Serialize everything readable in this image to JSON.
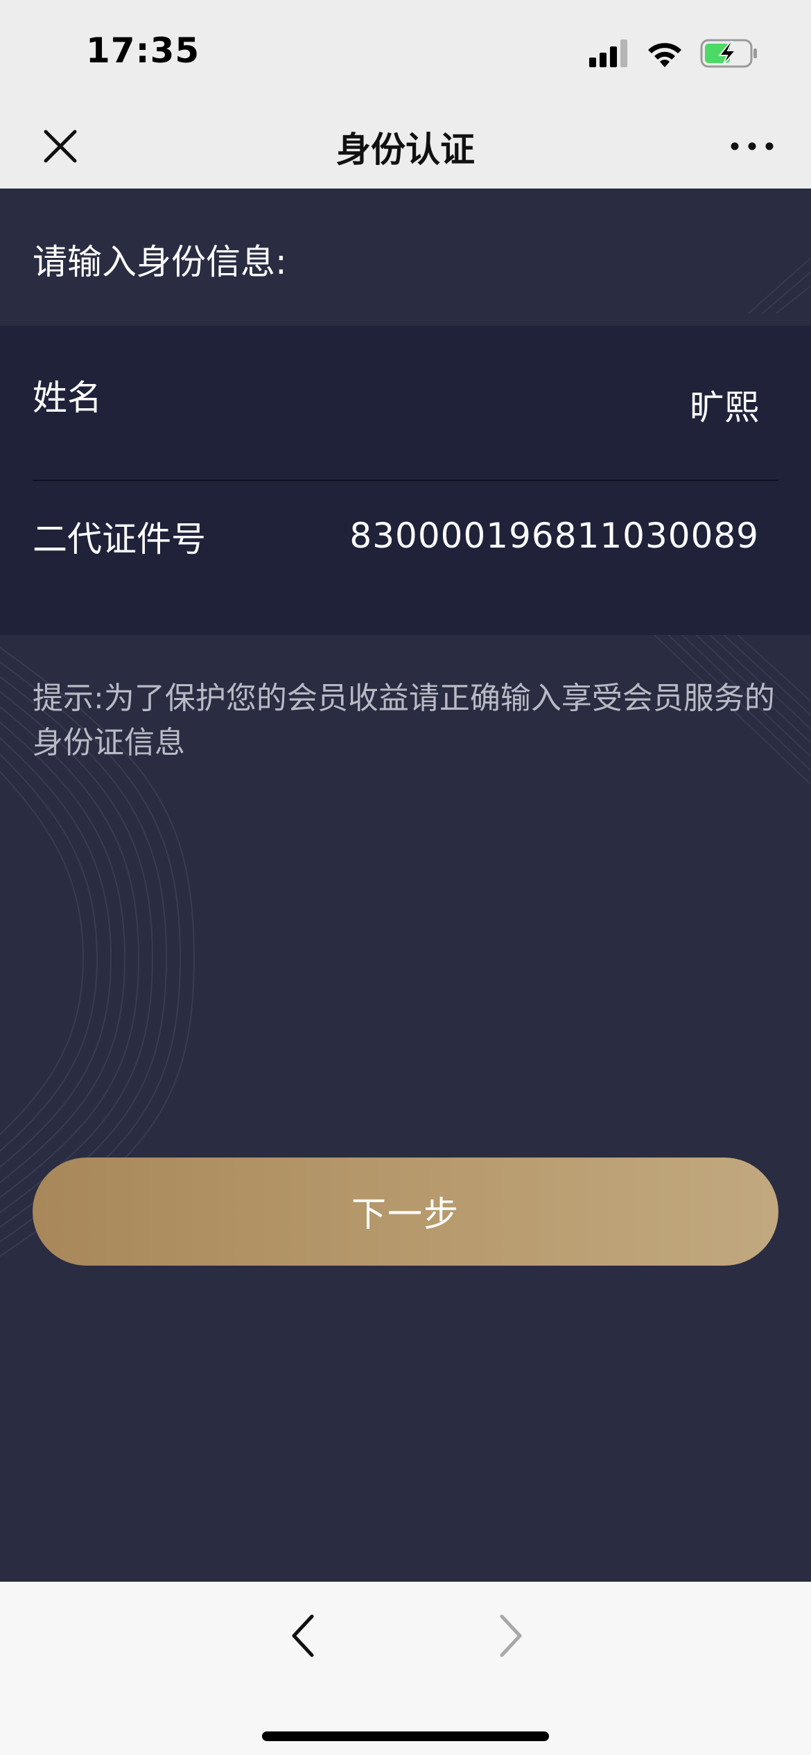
{
  "status_bar": {
    "time": "17:35",
    "icons": [
      "signal-icon",
      "wifi-icon",
      "battery-charging-icon"
    ]
  },
  "nav": {
    "title": "身份认证",
    "close_icon": "close-icon",
    "more_icon": "more-icon"
  },
  "form": {
    "prompt": "请输入身份信息:",
    "rows": [
      {
        "label": "姓名",
        "value": "旷熙"
      },
      {
        "label": "二代证件号",
        "value": "830000196811030089"
      }
    ]
  },
  "hint": "提示:为了保护您的会员收益请正确输入享受会员服务的身份证信息",
  "next_button_label": "下一步",
  "bottom_bar": {
    "back_icon": "chevron-left-icon",
    "forward_icon": "chevron-right-icon"
  },
  "colors": {
    "background": "#2a2c42",
    "card": "#20223a",
    "accent_gold": "#b79b6e",
    "battery_green": "#4cd964"
  }
}
